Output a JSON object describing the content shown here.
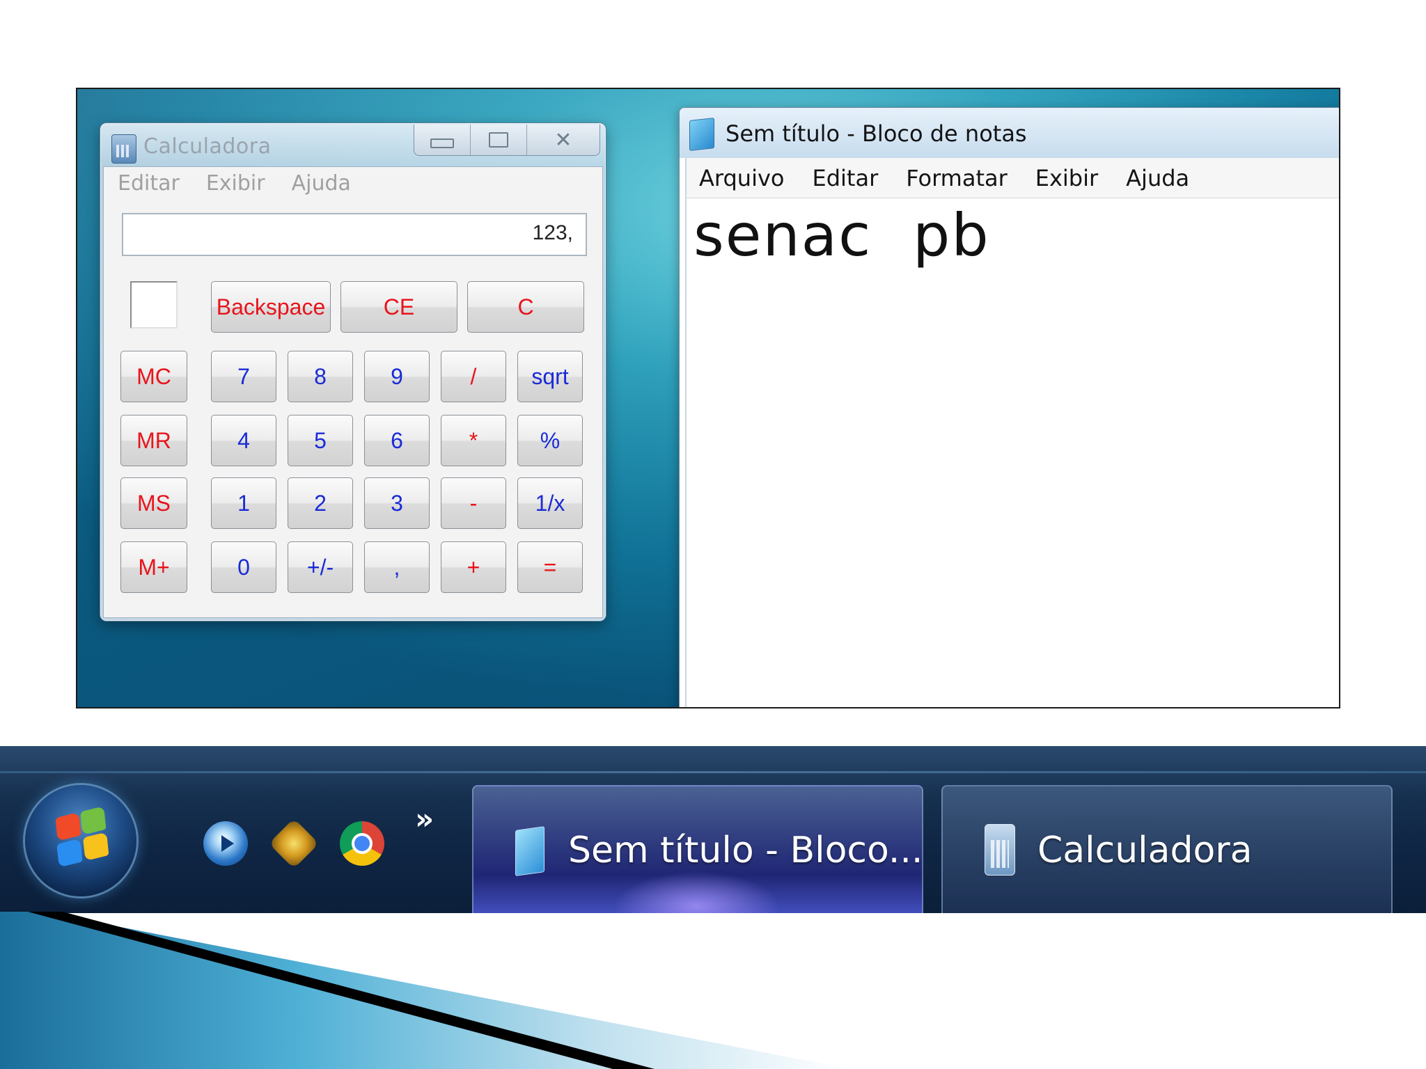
{
  "calculator": {
    "title": "Calculadora",
    "menu": [
      "Editar",
      "Exibir",
      "Ajuda"
    ],
    "display_value": "123,",
    "buttons": {
      "backspace": "Backspace",
      "ce": "CE",
      "c": "C",
      "mc": "MC",
      "mr": "MR",
      "ms": "MS",
      "mplus": "M+",
      "d7": "7",
      "d8": "8",
      "d9": "9",
      "d4": "4",
      "d5": "5",
      "d6": "6",
      "d1": "1",
      "d2": "2",
      "d3": "3",
      "d0": "0",
      "sign": "+/-",
      "decimal": ",",
      "divide": "/",
      "multiply": "*",
      "subtract": "-",
      "add": "+",
      "sqrt": "sqrt",
      "percent": "%",
      "reciprocal": "1/x",
      "equals": "="
    },
    "colors": {
      "operator_red": "#e8141c",
      "digit_blue": "#1a2bd6"
    }
  },
  "notepad": {
    "title": "Sem título - Bloco de notas",
    "menu": [
      "Arquivo",
      "Editar",
      "Formatar",
      "Exibir",
      "Ajuda"
    ],
    "content": "senac  pb"
  },
  "taskbar": {
    "quick_launch": [
      "windows-media-player-icon",
      "winamp-icon",
      "chrome-icon"
    ],
    "overflow": "»",
    "buttons": [
      {
        "label": "Sem título - Bloco...",
        "icon": "notepad-icon",
        "active": true
      },
      {
        "label": "Calculadora",
        "icon": "calculator-icon",
        "active": false
      }
    ]
  }
}
